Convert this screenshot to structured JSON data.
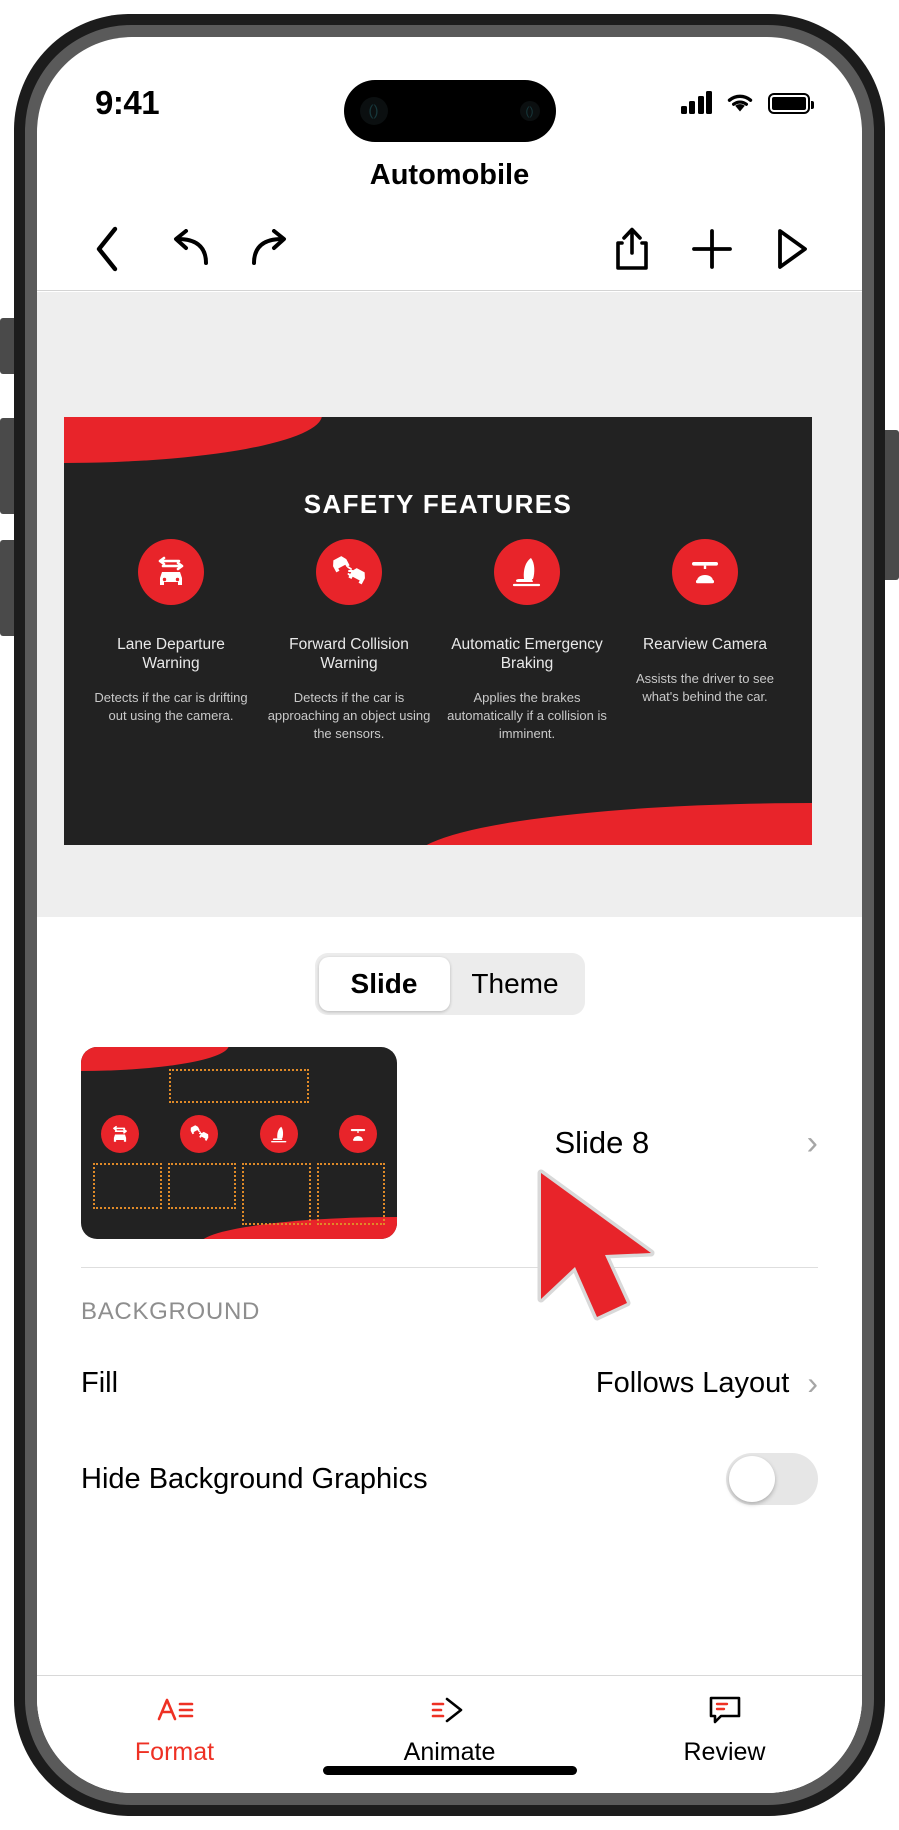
{
  "status_bar": {
    "time": "9:41",
    "cellular_icon": "cellular-signal-icon",
    "wifi_icon": "wifi-icon",
    "battery_icon": "battery-full-icon"
  },
  "document": {
    "title": "Automobile"
  },
  "toolbar": {
    "back": "back-chevron-icon",
    "undo": "undo-arrow-icon",
    "redo": "redo-arrow-icon",
    "share": "share-export-icon",
    "add": "add-plus-icon",
    "play": "play-triangle-icon"
  },
  "slide_canvas": {
    "title": "SAFETY FEATURES",
    "accent_color": "#e8242a",
    "background_color": "#222222",
    "features": [
      {
        "icon": "lane-departure-car-icon",
        "title": "Lane Departure Warning",
        "description": "Detects if the car is drifting out using the camera."
      },
      {
        "icon": "collision-cars-icon",
        "title": "Forward Collision Warning",
        "description": "Detects if the car is approaching an object using the sensors."
      },
      {
        "icon": "braking-seat-icon",
        "title": "Automatic Emergency Braking",
        "description": "Applies the brakes automatically if a collision is imminent."
      },
      {
        "icon": "rearview-camera-icon",
        "title": "Rearview Camera",
        "description": "Assists the driver to see what's behind the car."
      }
    ]
  },
  "panel": {
    "segmented": {
      "options": [
        "Slide",
        "Theme"
      ],
      "selected": "Slide"
    },
    "slide_row": {
      "label": "Slide 8",
      "chevron": "chevron-right-icon"
    },
    "section_header": "BACKGROUND",
    "rows": [
      {
        "label": "Fill",
        "value": "Follows Layout",
        "chevron": "chevron-right-icon"
      },
      {
        "label": "Hide Background Graphics",
        "toggle_state": "off"
      }
    ]
  },
  "tab_bar": {
    "active": "Format",
    "active_color": "#ee3124",
    "tabs": [
      {
        "label": "Format",
        "icon": "format-text-icon"
      },
      {
        "label": "Animate",
        "icon": "animate-arrow-icon"
      },
      {
        "label": "Review",
        "icon": "review-comment-icon"
      }
    ]
  },
  "cursor": {
    "icon": "mouse-pointer-arrow",
    "color": "#e8242a"
  }
}
